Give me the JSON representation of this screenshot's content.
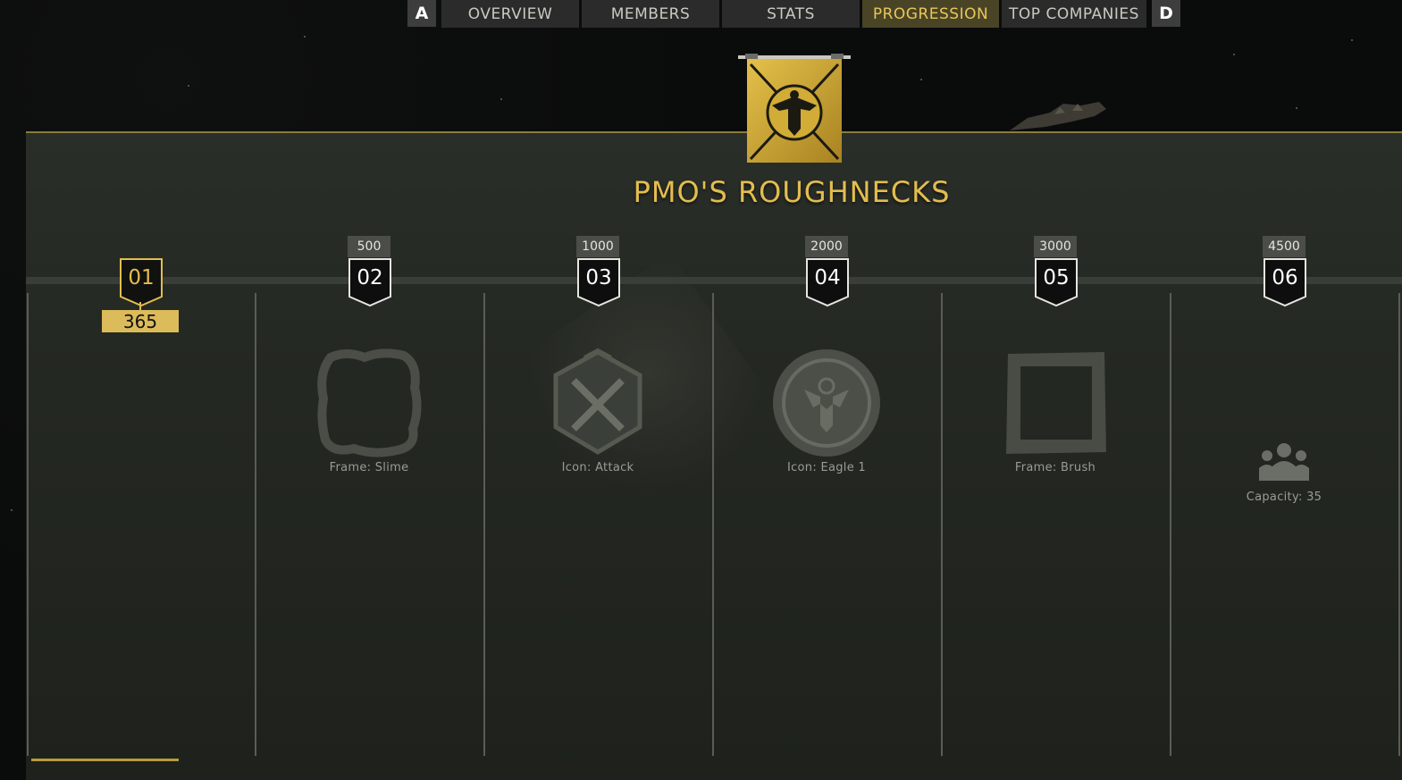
{
  "nav": {
    "left_key": "A",
    "right_key": "D",
    "tabs": [
      {
        "label": "OVERVIEW",
        "active": false
      },
      {
        "label": "MEMBERS",
        "active": false
      },
      {
        "label": "STATS",
        "active": false
      },
      {
        "label": "PROGRESSION",
        "active": true
      },
      {
        "label": "TOP COMPANIES",
        "active": false
      }
    ]
  },
  "company": {
    "name": "PMO'S ROUGHNECKS",
    "banner_icon": "eagle-emblem-icon"
  },
  "progression": {
    "current_points": "365",
    "levels": [
      {
        "level": "01",
        "threshold": "",
        "reward": "",
        "reward_icon": ""
      },
      {
        "level": "02",
        "threshold": "500",
        "reward": "Frame: Slime",
        "reward_icon": "slime-frame-icon"
      },
      {
        "level": "03",
        "threshold": "1000",
        "reward": "Icon: Attack",
        "reward_icon": "crossed-swords-icon"
      },
      {
        "level": "04",
        "threshold": "2000",
        "reward": "Icon: Eagle 1",
        "reward_icon": "eagle-globe-icon"
      },
      {
        "level": "05",
        "threshold": "3000",
        "reward": "Frame: Brush",
        "reward_icon": "brush-frame-icon"
      },
      {
        "level": "06",
        "threshold": "4500",
        "reward": "Capacity: 35",
        "reward_icon": "group-icon"
      }
    ]
  },
  "colors": {
    "accent_gold": "#e3bd4f",
    "active_tab_bg": "#4a4426",
    "panel_bg": "#252923"
  }
}
